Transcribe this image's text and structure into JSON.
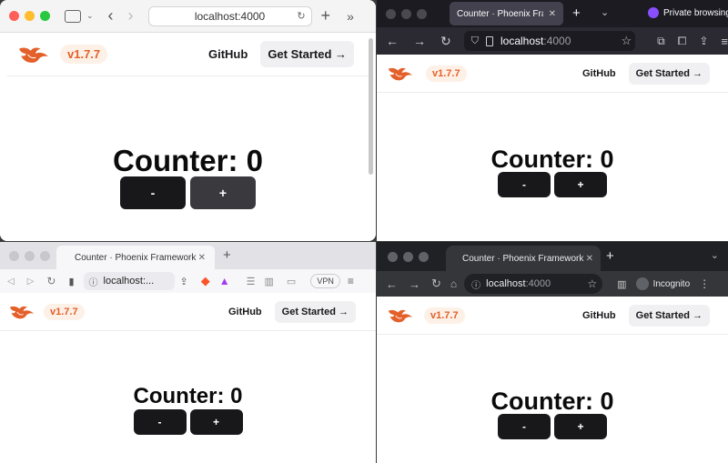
{
  "app": {
    "version": "v1.7.7",
    "github_label": "GitHub",
    "get_started_label": "Get Started →",
    "counter_label": "Counter: 0",
    "decrement_label": "-",
    "increment_label": "+"
  },
  "safari": {
    "url": "localhost:4000"
  },
  "firefox": {
    "tab_title": "Counter · Phoenix Fram",
    "private_label": "Private browsing",
    "url_host": "localhost",
    "url_port": ":4000"
  },
  "brave": {
    "tab_title": "Counter · Phoenix Framework",
    "url": "localhost:...",
    "vpn_label": "VPN"
  },
  "chrome": {
    "tab_title": "Counter · Phoenix Framework",
    "url_host": "localhost",
    "url_port": ":4000",
    "incognito_label": "Incognito"
  },
  "colors": {
    "phoenix_orange": "#e4602a",
    "button_dark": "#18181b"
  }
}
